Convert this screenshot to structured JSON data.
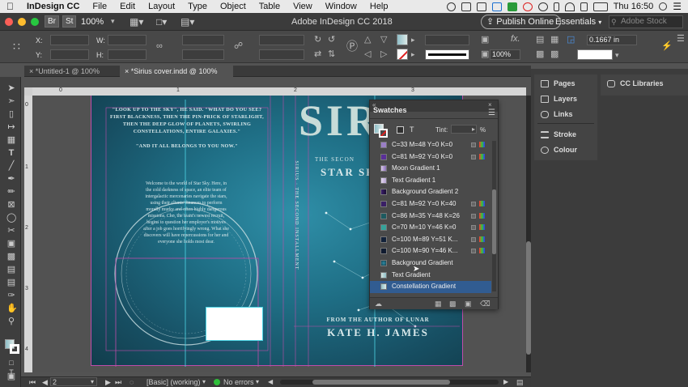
{
  "menubar": {
    "app_name": "InDesign CC",
    "items": [
      "File",
      "Edit",
      "Layout",
      "Type",
      "Object",
      "Table",
      "View",
      "Window",
      "Help"
    ],
    "clock": "Thu 16:50"
  },
  "titlebar": {
    "zoom": "100%",
    "title": "Adobe InDesign CC 2018",
    "publish_label": "Publish Online",
    "workspace": "Essentials",
    "search_placeholder": "Adobe Stock"
  },
  "control": {
    "x_label": "X:",
    "y_label": "Y:",
    "w_label": "W:",
    "h_label": "H:",
    "stroke_weight": "0.1667 in",
    "scale_value": "100%"
  },
  "tabs": [
    {
      "label": "*Untitled-1 @ 100%"
    },
    {
      "label": "*Sirius cover.indd @ 100%"
    }
  ],
  "ruler_marks": [
    "0",
    "1",
    "2",
    "3",
    "4"
  ],
  "cover": {
    "back_text_quote": "\"LOOK UP TO THE SKY\", HE SAID. \"WHAT DO YOU SEE? FIRST BLACKNESS, THEN THE PIN-PRICK OF STARLIGHT, THEN THE DEEP GLOW OF PLANETS, SWIRLING CONSTELLATIONS, ENTIRE GALAXIES.\"",
    "back_text_quote2": "\"AND IT ALL BELONGS TO YOU NOW.\"",
    "blurb": "Welcome to the world of Star Sky. Here, in the cold darkness of space, an elite team of intergalactic mercenaries navigate the stars, using their clients' finances to perform morally murky and often highly dangerous missions. Cho, the team's newest recruit, begins to question her employer's motives after a job goes horrifyingly wrong. What she discovers will have repercussions for her and everyone she holds most dear.",
    "spine_text": "SIRIUS · THE SECOND INSTALLMENT",
    "front_title": "SIR",
    "front_series": "THE SECON",
    "front_subtitle": "STAR SKY",
    "from_author": "FROM THE AUTHOR OF LUNAR",
    "author": "KATE H. JAMES"
  },
  "panels": {
    "stack1": [
      "Pages",
      "Layers",
      "Links",
      "Stroke",
      "Colour"
    ],
    "libraries": "CC Libraries"
  },
  "swatches": {
    "title": "Swatches",
    "tint_label": "Tint:",
    "tint_unit": "%",
    "items": [
      {
        "name": "C=33 M=48 Y=0 K=0",
        "color": "#9a7fc6",
        "badges": true
      },
      {
        "name": "C=81 M=92 Y=0 K=0",
        "color": "#5a2f98",
        "badges": true
      },
      {
        "name": "Moon Gradient 1",
        "color": "#d9c8e8",
        "badges": false
      },
      {
        "name": "Text Gradient 1",
        "color": "#e3d8ef",
        "badges": false
      },
      {
        "name": "Background Gradient 2",
        "color": "#3b1f6d",
        "badges": false
      },
      {
        "name": "C=81 M=92 Y=0 K=40",
        "color": "#3a1f66",
        "badges": true
      },
      {
        "name": "C=86 M=35 Y=48 K=26",
        "color": "#1d5a60",
        "badges": true
      },
      {
        "name": "C=70 M=10 Y=46 K=0",
        "color": "#35a39a",
        "badges": true
      },
      {
        "name": "C=100 M=89 Y=51 K...",
        "color": "#12223a",
        "badges": true
      },
      {
        "name": "C=100 M=90 Y=46 K...",
        "color": "#101b30",
        "badges": true
      },
      {
        "name": "Background Gradient",
        "color": "#1d6a78",
        "badges": false
      },
      {
        "name": "Text Gradient",
        "color": "#d6e4e0",
        "badges": false
      },
      {
        "name": "Constellation Gradient",
        "color": "#8fbfc8",
        "badges": false,
        "selected": true
      }
    ]
  },
  "status": {
    "page": "2",
    "master": "[Basic] (working)",
    "errors": "No errors"
  }
}
